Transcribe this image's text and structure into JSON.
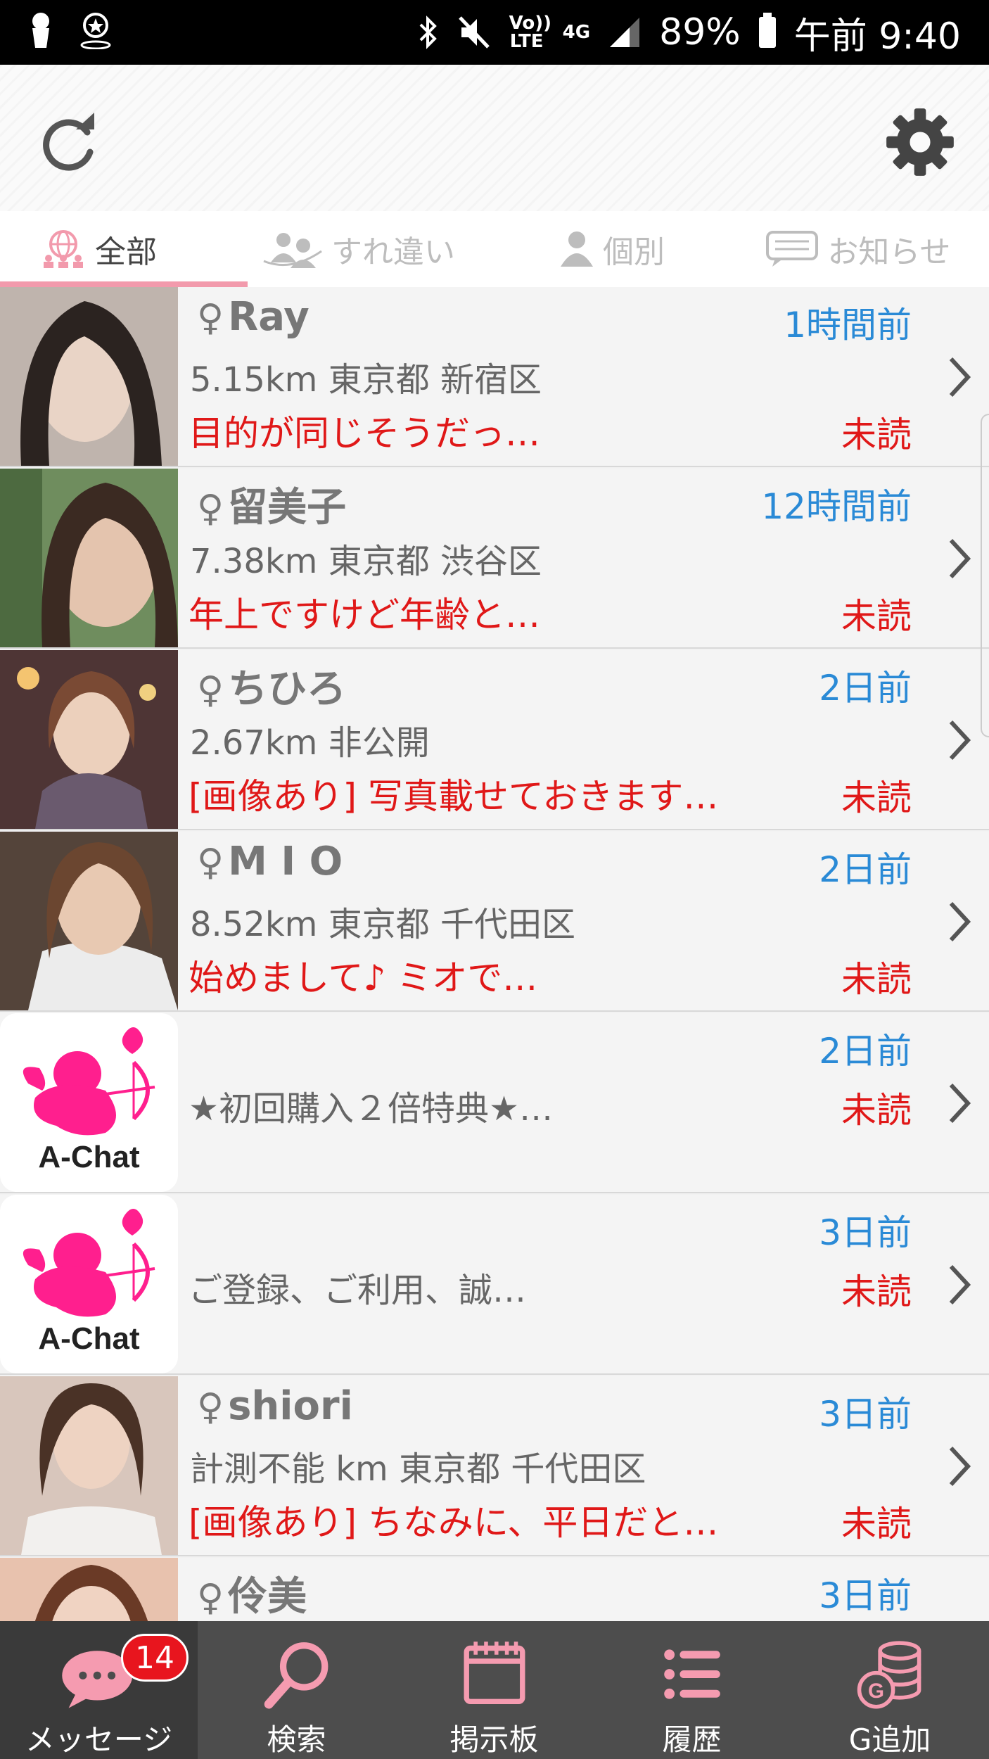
{
  "status_bar": {
    "network": "Vo)) LTE",
    "network_type": "4G",
    "battery": "89%",
    "time": "午前 9:40"
  },
  "header": {
    "refresh_icon": "refresh-icon",
    "settings_icon": "gear-icon"
  },
  "tabs": [
    {
      "label": "全部",
      "icon": "globe-people-icon",
      "active": true
    },
    {
      "label": "すれ違い",
      "icon": "passing-people-icon",
      "active": false
    },
    {
      "label": "個別",
      "icon": "person-icon",
      "active": false
    },
    {
      "label": "お知らせ",
      "icon": "chat-bubble-icon",
      "active": false
    }
  ],
  "messages": [
    {
      "name": "Ray",
      "gender": "♀",
      "time": "1時間前",
      "location": "5.15km 東京都 新宿区",
      "preview": "目的が同じそうだっ…",
      "status": "未読",
      "avatar_color": "#c8b6ae"
    },
    {
      "name": "留美子",
      "gender": "♀",
      "time": "12時間前",
      "location": "7.38km 東京都 渋谷区",
      "preview": "年上ですけど年齢と…",
      "status": "未読",
      "avatar_color": "#9a8778"
    },
    {
      "name": "ちひろ",
      "gender": "♀",
      "time": "2日前",
      "location": "2.67km 非公開",
      "preview": "[画像あり] 写真載せておきます…",
      "status": "未読",
      "avatar_color": "#6b5050"
    },
    {
      "name": "M I O",
      "gender": "♀",
      "time": "2日前",
      "location": "8.52km 東京都 千代田区",
      "preview": "始めまして♪ ミオで…",
      "status": "未読",
      "avatar_color": "#5a4a40"
    },
    {
      "system": true,
      "logo_text": "A-Chat",
      "time": "2日前",
      "preview": "★初回購入２倍特典★…",
      "status": "未読"
    },
    {
      "system": true,
      "logo_text": "A-Chat",
      "time": "3日前",
      "preview": "ご登録、ご利用、誠…",
      "status": "未読"
    },
    {
      "name": "shiori",
      "gender": "♀",
      "time": "3日前",
      "location": "計測不能 km 東京都 千代田区",
      "preview": "[画像あり] ちなみに、平日だと…",
      "status": "未読",
      "avatar_color": "#b89a8a"
    },
    {
      "name": "伶美",
      "gender": "♀",
      "time": "3日前",
      "location": "",
      "preview": "",
      "status": "",
      "avatar_color": "#c9a48f"
    }
  ],
  "bottom_nav": [
    {
      "label": "メッセージ",
      "icon": "chat-bubble-icon",
      "badge": "14",
      "active": true
    },
    {
      "label": "検索",
      "icon": "search-icon",
      "active": false
    },
    {
      "label": "掲示板",
      "icon": "notepad-icon",
      "active": false
    },
    {
      "label": "履歴",
      "icon": "list-icon",
      "active": false
    },
    {
      "label": "G追加",
      "icon": "coins-icon",
      "active": false
    }
  ],
  "colors": {
    "accent_pink": "#f29aac",
    "time_blue": "#2a8ad6",
    "unread_red": "#e01818",
    "nav_bg": "#4d4d4d",
    "logo_pink": "#ff1f8e"
  }
}
